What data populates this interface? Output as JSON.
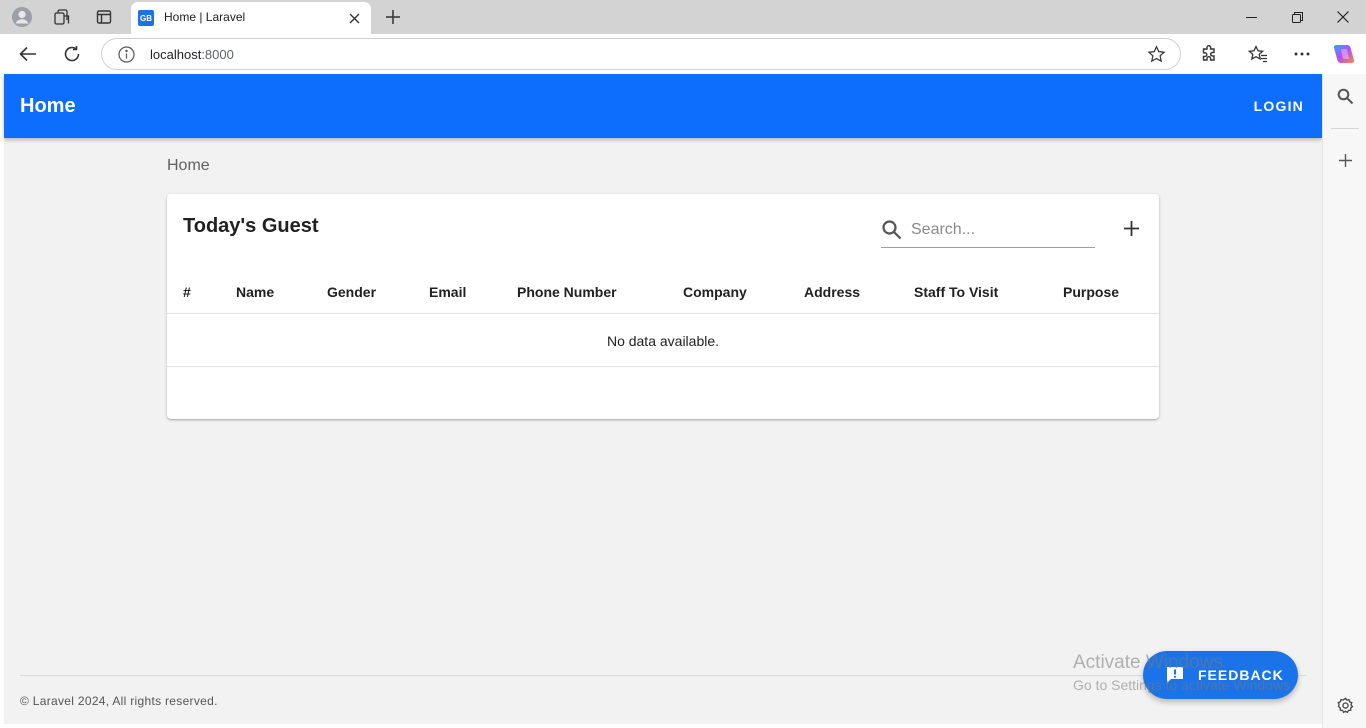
{
  "browser": {
    "tab": {
      "favicon_text": "GB",
      "title": "Home | Laravel"
    },
    "address": {
      "host": "localhost",
      "port": ":8000"
    }
  },
  "app": {
    "brand": "Home",
    "login_label": "LOGIN",
    "accent_color": "#0d6efd"
  },
  "breadcrumb": "Home",
  "card": {
    "title": "Today's Guest",
    "search_placeholder": "Search...",
    "columns": [
      "#",
      "Name",
      "Gender",
      "Email",
      "Phone Number",
      "Company",
      "Address",
      "Staff To Visit",
      "Purpose"
    ],
    "empty_text": "No data available."
  },
  "footer": {
    "text": "© Laravel 2024, All rights reserved."
  },
  "feedback": {
    "label": "FEEDBACK"
  },
  "watermark": {
    "line1": "Activate Windows",
    "line2": "Go to Settings to activate Windows."
  },
  "icons": [
    "profile-icon",
    "workspaces-icon",
    "tab-actions-icon",
    "close-icon",
    "plus-icon",
    "minimize-icon",
    "restore-icon",
    "back-icon",
    "refresh-icon",
    "info-icon",
    "star-icon",
    "extensions-icon",
    "favorites-icon",
    "more-icon",
    "copilot-icon",
    "search-icon",
    "settings-icon",
    "feedback-icon"
  ]
}
